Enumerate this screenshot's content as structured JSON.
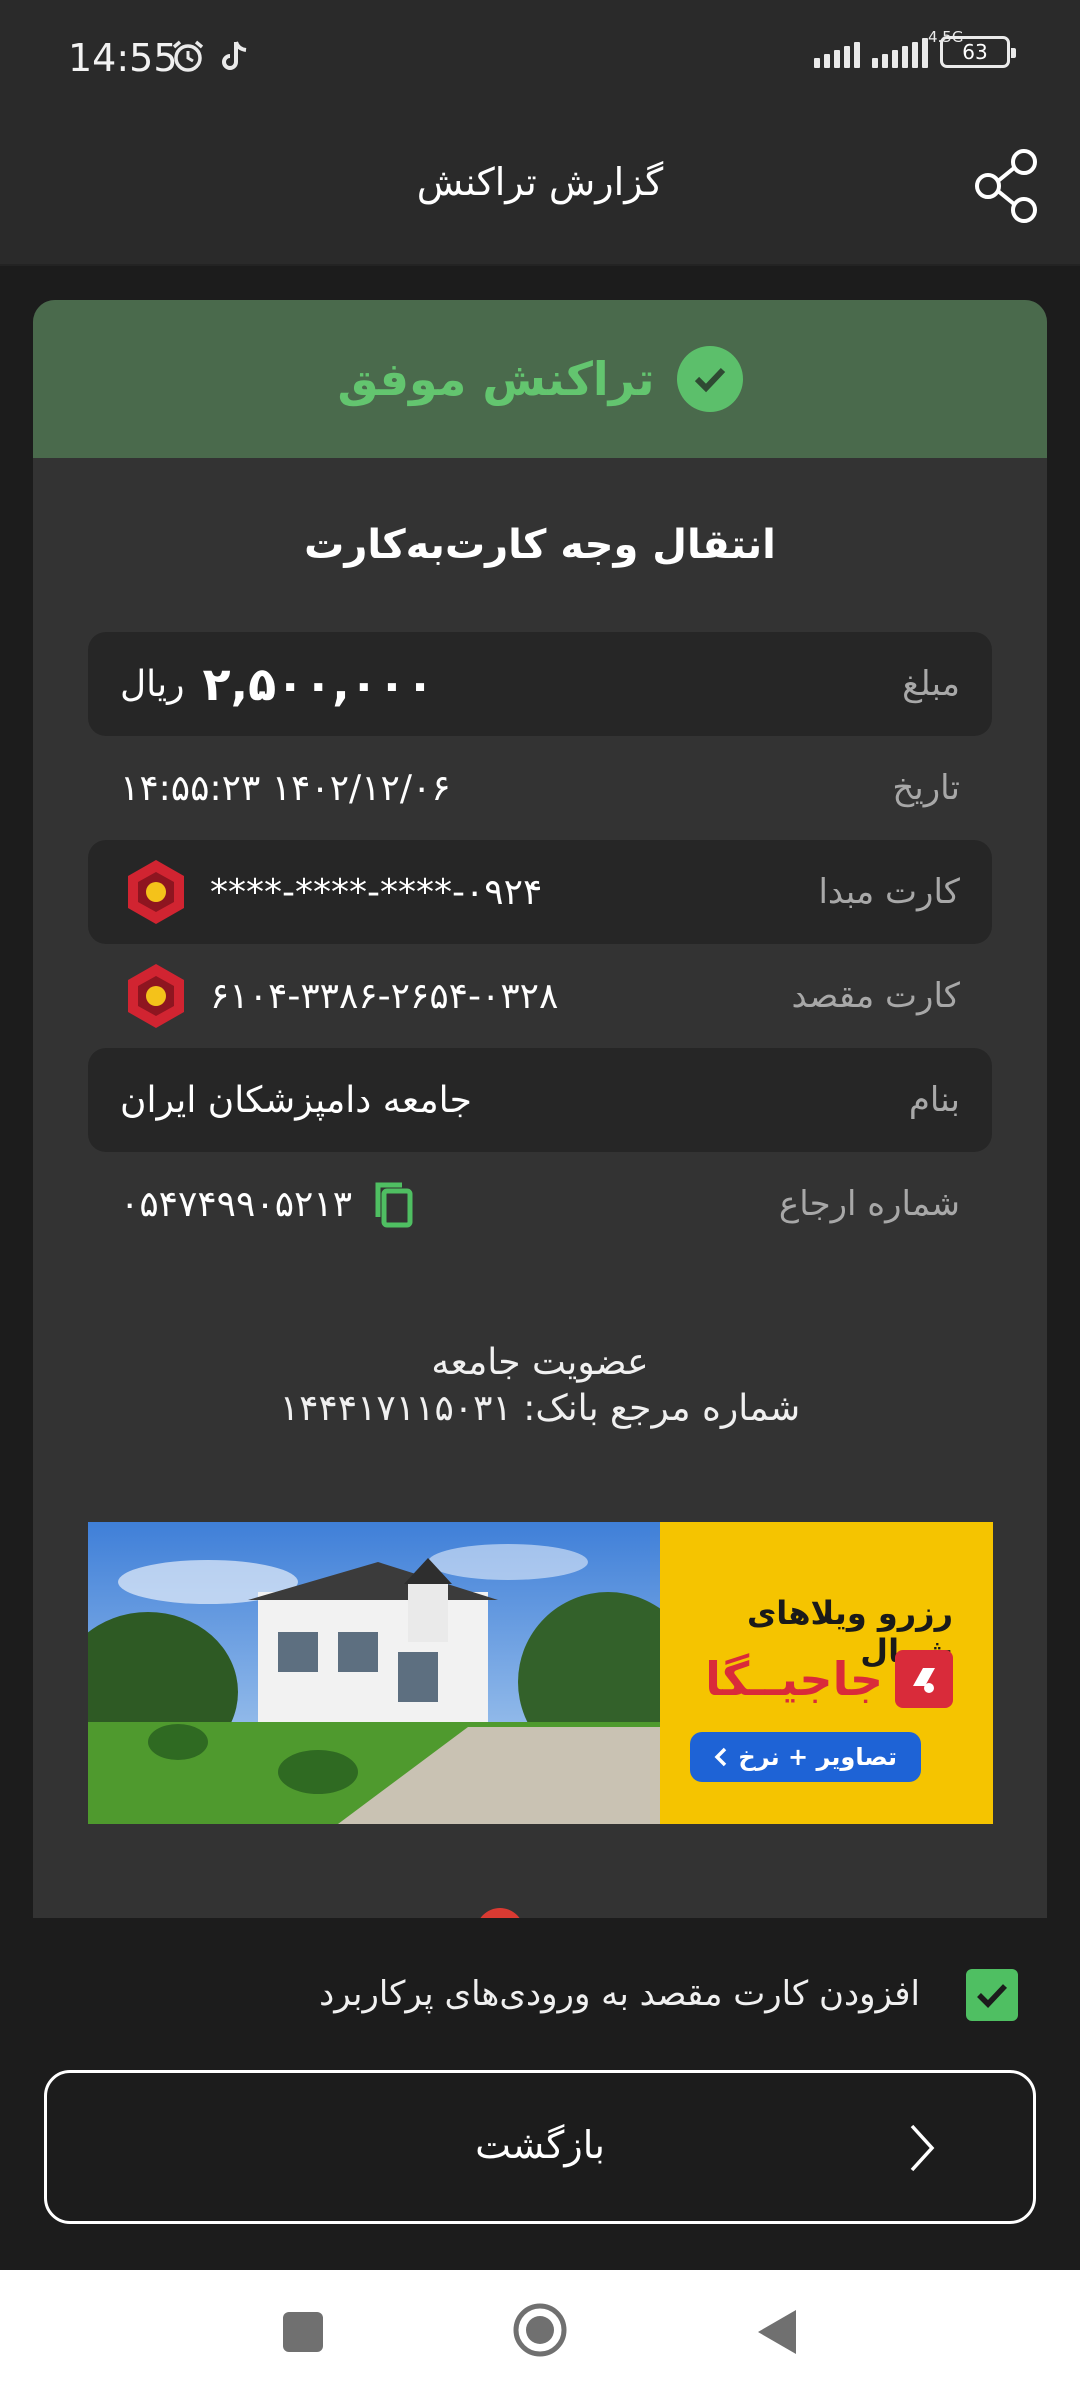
{
  "status_bar": {
    "time": "14:55",
    "network": "4.5G",
    "battery": "63",
    "icons": [
      "alarm-icon",
      "tiktok-icon",
      "signal-icon",
      "battery-icon"
    ]
  },
  "app_bar": {
    "title": "گزارش تراکنش",
    "share_icon": "share-icon"
  },
  "receipt": {
    "status": "تراکنش موفق",
    "title": "انتقال وجه کارت‌به‌کارت",
    "amount": {
      "label": "مبلغ",
      "value": "۲,۵۰۰,۰۰۰",
      "unit": "ریال"
    },
    "date": {
      "label": "تاریخ",
      "value": "۱۴:۵۵:۲۳ ۱۴۰۲/۱۲/۰۶"
    },
    "source_card": {
      "label": "کارت مبدا",
      "value": "****-****-****-۰۹۲۴"
    },
    "dest_card": {
      "label": "کارت مقصد",
      "value": "۶۱۰۴-۳۳۸۶-۲۶۵۴-۰۳۲۸"
    },
    "name": {
      "label": "بنام",
      "value": "جامعه دامپزشکان ایران"
    },
    "reference": {
      "label": "شماره ارجاع",
      "value": "۰۵۴۷۴۹۹۰۵۲۱۳"
    },
    "note_line1": "عضویت جامعه",
    "note_line2": "شماره مرجع بانک: ۱۴۴۴۱۷۱۱۵۰۳۱"
  },
  "banner": {
    "headline": "رزرو ویلاهای شمال",
    "brand": "جاجیــگا",
    "button": "تصاویر + نرخ"
  },
  "footer": {
    "checkbox_label": "افزودن کارت مقصد به ورودی‌های پرکاربرد",
    "checkbox_checked": true,
    "back_button": "بازگشت"
  },
  "colors": {
    "success_green": "#63c56f",
    "header_green": "#4a6a4c",
    "background": "#1c1c1c",
    "card": "#333333",
    "bank_red": "#d12431",
    "ad_yellow": "#f5c400"
  }
}
